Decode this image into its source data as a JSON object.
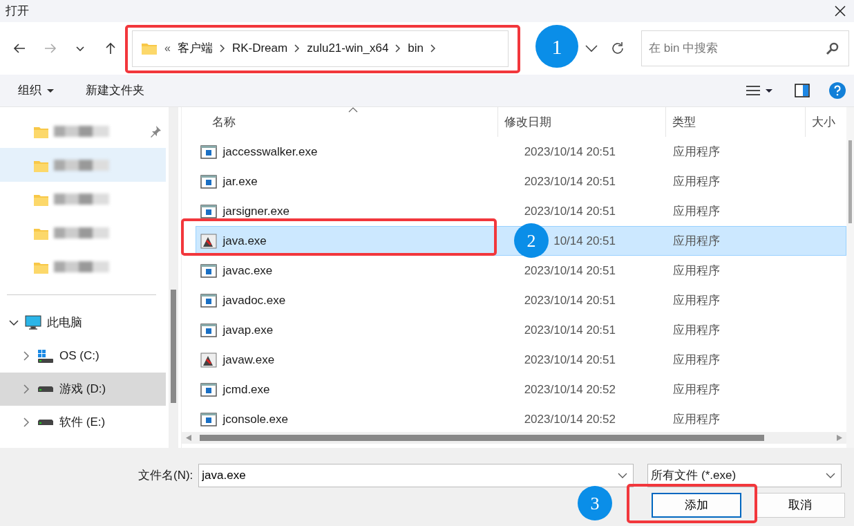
{
  "window": {
    "title": "打开"
  },
  "nav": {
    "forward_disabled": true
  },
  "address": {
    "overflow": "«",
    "crumbs": [
      "客户端",
      "RK-Dream",
      "zulu21-win_x64",
      "bin"
    ]
  },
  "search": {
    "placeholder": "在 bin 中搜索"
  },
  "toolbar": {
    "organize": "组织",
    "new_folder": "新建文件夹"
  },
  "sidebar": {
    "quick_access": [
      {
        "selected": false,
        "pinned": true
      },
      {
        "selected": true,
        "pinned": false
      },
      {
        "selected": false,
        "pinned": false
      },
      {
        "selected": false,
        "pinned": false
      },
      {
        "selected": false,
        "pinned": false
      }
    ],
    "tree": [
      {
        "label": "此电脑",
        "kind": "pc",
        "expanded": true,
        "selected": false,
        "children": [
          {
            "label": "OS (C:)",
            "kind": "system",
            "expanded": false,
            "selected": false
          },
          {
            "label": "游戏 (D:)",
            "kind": "drive",
            "expanded": false,
            "selected": true
          },
          {
            "label": "软件 (E:)",
            "kind": "drive",
            "expanded": false,
            "selected": false
          }
        ]
      }
    ]
  },
  "table": {
    "columns": [
      "名称",
      "修改日期",
      "类型",
      "大小"
    ],
    "rows": [
      {
        "name": "jaccesswalker.exe",
        "kind": "console",
        "date": "2023/10/14 20:51",
        "type": "应用程序",
        "selected": false
      },
      {
        "name": "jar.exe",
        "kind": "console",
        "date": "2023/10/14 20:51",
        "type": "应用程序",
        "selected": false
      },
      {
        "name": "jarsigner.exe",
        "kind": "console",
        "date": "2023/10/14 20:51",
        "type": "应用程序",
        "selected": false
      },
      {
        "name": "java.exe",
        "kind": "java",
        "date": "10/14 20:51",
        "type": "应用程序",
        "selected": true
      },
      {
        "name": "javac.exe",
        "kind": "console",
        "date": "2023/10/14 20:51",
        "type": "应用程序",
        "selected": false
      },
      {
        "name": "javadoc.exe",
        "kind": "console",
        "date": "2023/10/14 20:51",
        "type": "应用程序",
        "selected": false
      },
      {
        "name": "javap.exe",
        "kind": "console",
        "date": "2023/10/14 20:51",
        "type": "应用程序",
        "selected": false
      },
      {
        "name": "javaw.exe",
        "kind": "java",
        "date": "2023/10/14 20:51",
        "type": "应用程序",
        "selected": false
      },
      {
        "name": "jcmd.exe",
        "kind": "console",
        "date": "2023/10/14 20:52",
        "type": "应用程序",
        "selected": false
      },
      {
        "name": "jconsole.exe",
        "kind": "console",
        "date": "2023/10/14 20:52",
        "type": "应用程序",
        "selected": false
      }
    ]
  },
  "footer": {
    "filename_label": "文件名(N):",
    "filename": "java.exe",
    "filter": "所有文件 (*.exe)",
    "buttons": [
      {
        "label": "添加",
        "focused": true
      },
      {
        "label": "取消",
        "focused": false
      }
    ]
  },
  "annotations": [
    {
      "label": "1"
    },
    {
      "label": "2"
    },
    {
      "label": "3"
    }
  ]
}
